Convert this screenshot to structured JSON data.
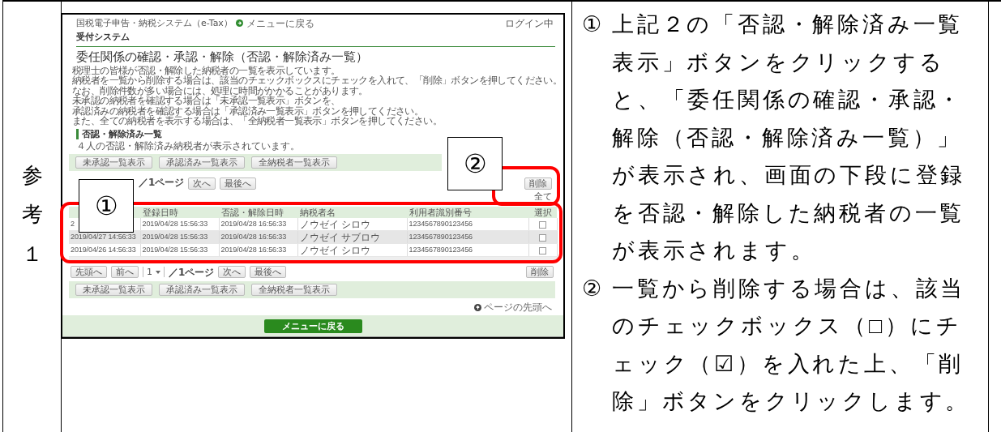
{
  "document": {
    "label": "参考１",
    "screenshot": {
      "header": {
        "system_name": "国税電子申告・納税システム（e-Tax）",
        "menu_link": "メニューに戻る",
        "login_status": "ログイン中",
        "subsystem": "受付システム"
      },
      "title": "委任関係の確認・承認・解除（否認・解除済み一覧）",
      "instructions": [
        "税理士の皆様が否認・解除した納税者の一覧を表示しています。",
        "納税者を一覧から削除する場合は、該当のチェックボックスにチェックを入れて、「削除」ボタンを押してください。",
        "なお、削除件数が多い場合には、処理に時間がかかることがあります。",
        "未承認の納税者を確認する場合は「未承認一覧表示」ボタンを、",
        "承認済みの納税者を確認する場合は「承認済み一覧表示」ボタンを押してください。",
        "また、全ての納税者を表示する場合は、「全納税者一覧表示」ボタンを押してください。"
      ],
      "section_title": "否認・解除済み一覧",
      "result_count": "４人の否認・解除済み納税者が表示されています。",
      "view_buttons": [
        "未承認一覧表示",
        "承認済み一覧表示",
        "全納税者一覧表示"
      ],
      "top_pager": [
        {
          "kind": "text",
          "label": "／1ページ"
        },
        {
          "kind": "button",
          "label": "次へ"
        },
        {
          "kind": "button",
          "label": "最後へ"
        }
      ],
      "delete_button": "削除",
      "select_all": "全て",
      "table": {
        "columns": [
          {
            "kind": "datetime"
          },
          {
            "label": "登録日時",
            "kind": "datetime"
          },
          {
            "label": "否認・解除日時",
            "kind": "datetime"
          },
          {
            "label": "納税者名",
            "kind": "text"
          },
          {
            "label": "利用者識別番号",
            "kind": "number"
          },
          {
            "label": "選択",
            "kind": "checkbox"
          }
        ],
        "rows": [
          {
            "cells": [
              "2",
              "2019/04/28 15:56:33",
              "2019/04/28 16:56:33",
              "ノウゼイ シロウ",
              "1234567890123456"
            ],
            "checked": false
          },
          {
            "cells": [
              "2019/04/27 14:56:33",
              "2019/04/28 15:56:33",
              "2019/04/28 16:56:33",
              "ノウゼイ サブロウ",
              "1234567890123456"
            ],
            "checked": false
          },
          {
            "cells": [
              "2019/04/26 14:56:33",
              "2019/04/28 15:56:33",
              "2019/04/28 16:56:33",
              "ノウゼイ シロウ",
              "1234567890123456"
            ],
            "checked": false
          }
        ]
      },
      "bottom_pager": [
        {
          "kind": "button",
          "label": "先頭へ"
        },
        {
          "kind": "button",
          "label": "前へ"
        },
        {
          "kind": "select",
          "value": "1"
        },
        {
          "kind": "text",
          "label": "／1ページ"
        },
        {
          "kind": "button",
          "label": "次へ"
        },
        {
          "kind": "button",
          "label": "最後へ"
        }
      ],
      "bottom_delete_button": "削除",
      "bottom_view_buttons": [
        "未承認一覧表示",
        "承認済み一覧表示",
        "全納税者一覧表示"
      ],
      "page_top_link": "ページの先頭へ",
      "menu_button": "メニューに戻る"
    },
    "callouts": [
      {
        "label": "①"
      },
      {
        "label": "②"
      }
    ],
    "notes": [
      {
        "marker": "①",
        "text": "上記２の「否認・解除済み一覧表示」ボタンをクリックすると、「委任関係の確認・承認・解除（否認・解除済み一覧）」が表示され、画面の下段に登録を否認・解除した納税者の一覧が表示されます。"
      },
      {
        "marker": "②",
        "text": "一覧から削除する場合は、該当のチェックボックス（□）にチェック（☑）を入れた上、「削除」ボタンをクリックします。"
      }
    ]
  }
}
